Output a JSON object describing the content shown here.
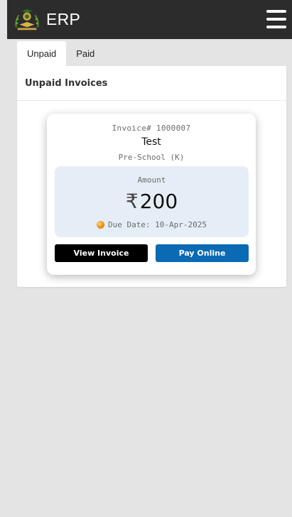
{
  "header": {
    "title": "ERP",
    "logo_icon": "school-logo-icon",
    "menu_icon": "hamburger-menu-icon",
    "background": "#2c2c2c"
  },
  "tabs": [
    {
      "label": "Unpaid",
      "active": true
    },
    {
      "label": "Paid",
      "active": false
    }
  ],
  "panel": {
    "title": "Unpaid Invoices"
  },
  "invoice": {
    "number_label": "Invoice# 1000007",
    "name": "Test",
    "class": "Pre-School (K)",
    "amount_label": "Amount",
    "currency": "₹",
    "amount": "200",
    "due_date": "Due Date: 10-Apr-2025",
    "status_color": "#f08a0c",
    "view_button": "View Invoice",
    "pay_button": "Pay Online",
    "pay_color": "#0a6ab3"
  }
}
